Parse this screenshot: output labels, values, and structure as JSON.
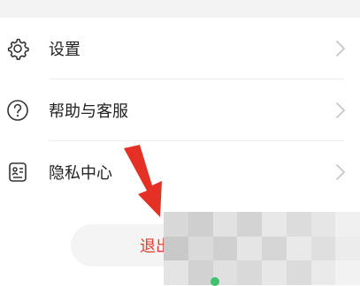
{
  "menu": {
    "items": [
      {
        "label": "设置",
        "icon": "gear-icon"
      },
      {
        "label": "帮助与客服",
        "icon": "question-circle-icon"
      },
      {
        "label": "隐私中心",
        "icon": "privacy-card-icon"
      }
    ]
  },
  "logout": {
    "label": "退出"
  },
  "colors": {
    "accent": "#e33c2f",
    "annotation_arrow": "#e53026",
    "text": "#222222",
    "chevron": "#c7c7c7"
  }
}
